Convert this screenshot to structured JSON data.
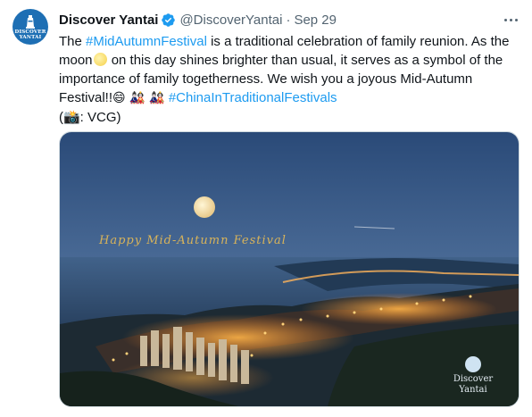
{
  "tweet": {
    "display_name": "Discover Yantai",
    "handle": "@DiscoverYantai",
    "separator": "·",
    "date": "Sep 29",
    "avatar_text_line1": "DISCOVER",
    "avatar_text_line2": "YANTAI",
    "text": {
      "t1": "The ",
      "hashtag1": "#MidAutumnFestival",
      "t2": " is a traditional celebration of family reunion. As the moon",
      "moon_emoji": "🌕",
      "t3": " on this day shines brighter than usual, it serves as a symbol of the importance of family togetherness. We wish you a joyous Mid-Autumn Festival!!",
      "emojis": "😄 🎎 🎎 ",
      "hashtag2": "#ChinaInTraditionalFestivals",
      "credit": "(📸: VCG)"
    },
    "media": {
      "overlay_caption": "Happy Mid-Autumn Festival",
      "watermark_line1": "Discover",
      "watermark_line2": "Yantai"
    }
  },
  "colors": {
    "link": "#1d9bf0",
    "verified": "#1d9bf0",
    "muted": "#536471",
    "avatar_bg": "#1e6fb4"
  },
  "icons": [
    "verified-badge-icon",
    "more-options-icon",
    "lighthouse-logo-icon"
  ]
}
